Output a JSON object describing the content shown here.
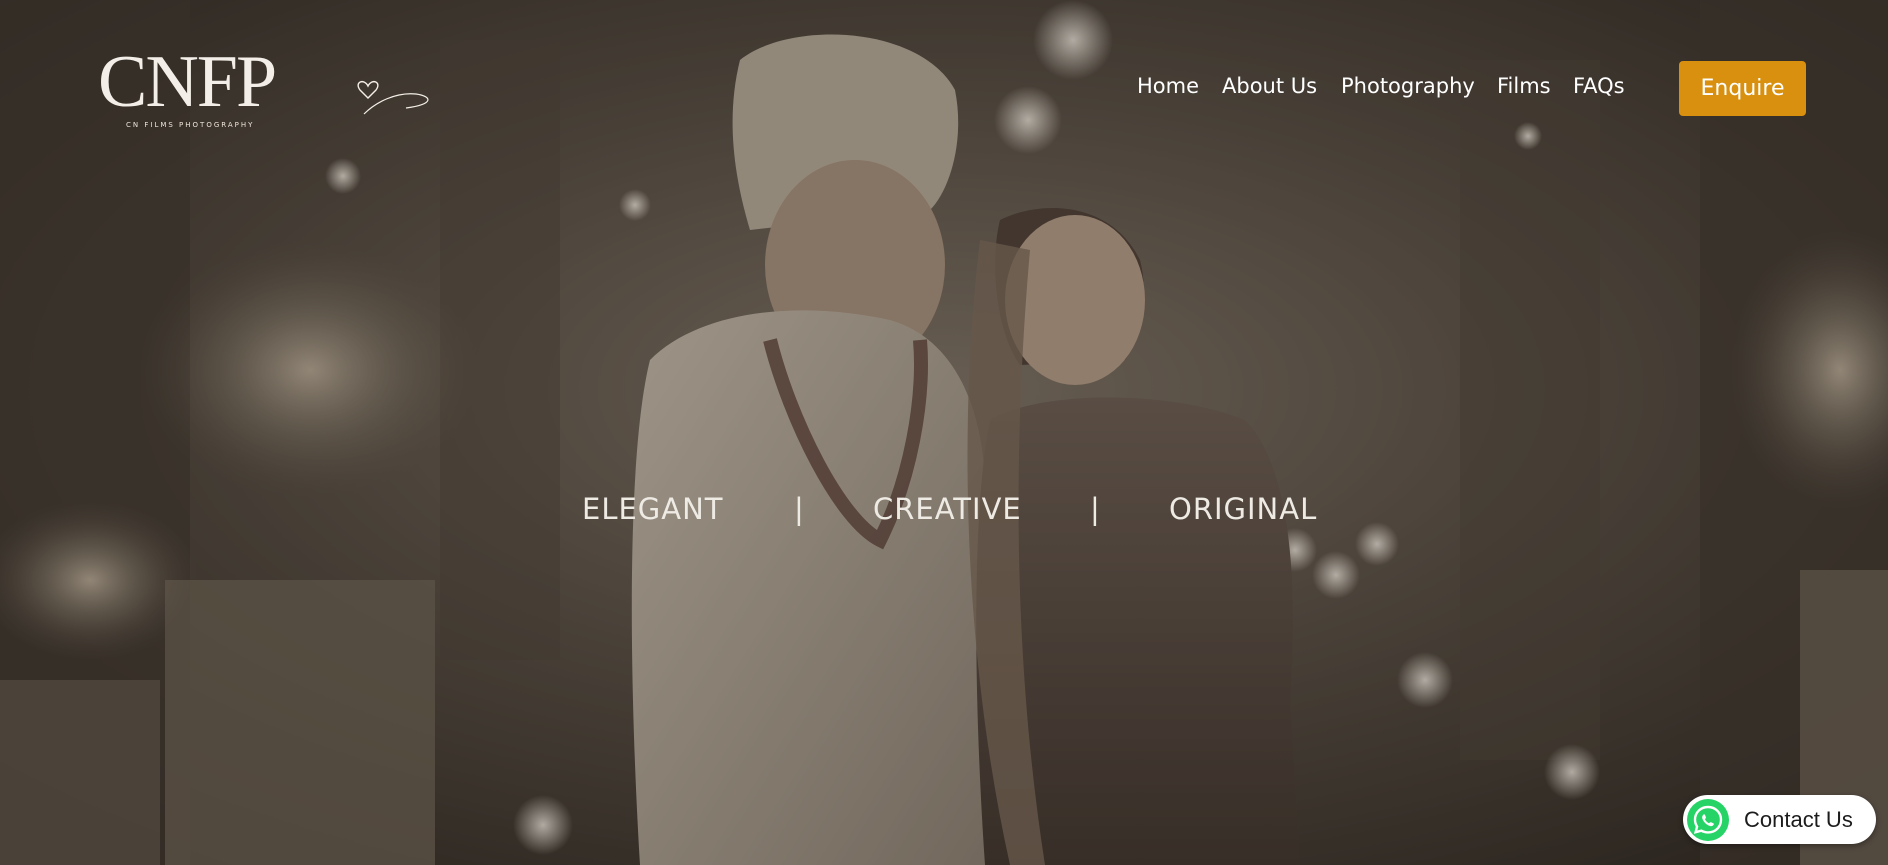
{
  "brand": {
    "logo_text": "CNFP",
    "logo_tagline": "CN FILMS PHOTOGRAPHY"
  },
  "nav": {
    "items": [
      {
        "label": "Home"
      },
      {
        "label": "About Us"
      },
      {
        "label": "Photography"
      },
      {
        "label": "Films"
      },
      {
        "label": "FAQs"
      }
    ],
    "cta_label": "Enquire"
  },
  "hero": {
    "tagline": [
      "ELEGANT",
      "|",
      "CREATIVE",
      "|",
      "ORIGINAL"
    ],
    "background_icon": "wedding-couple-photo"
  },
  "contact_widget": {
    "label": "Contact Us",
    "icon": "whatsapp-icon"
  },
  "colors": {
    "accent": "#d8900e",
    "whatsapp": "#25d366",
    "overlay": "#2e2822"
  }
}
